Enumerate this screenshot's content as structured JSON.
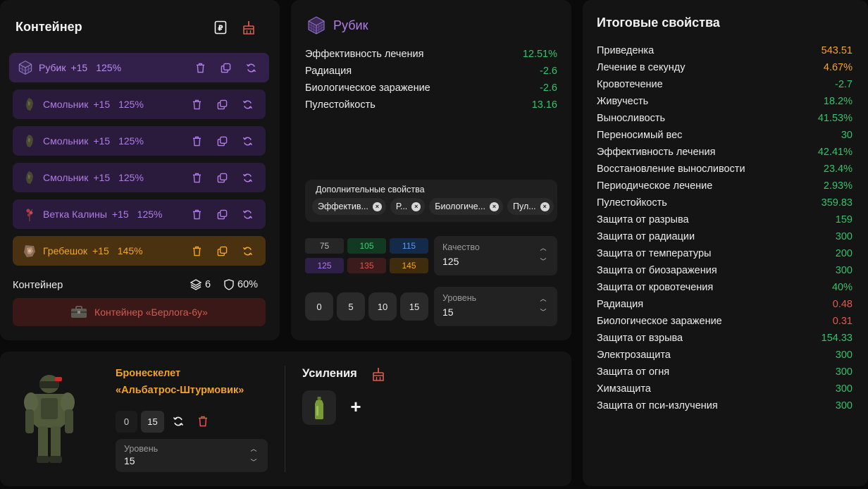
{
  "container": {
    "title": "Контейнер",
    "artifacts": [
      {
        "name": "Рубик",
        "level": "+15",
        "quality": "125%",
        "style": "purple-sel",
        "icon": "rubik-cube-icon"
      },
      {
        "name": "Смольник",
        "level": "+15",
        "quality": "125%",
        "style": "purple",
        "icon": "resin-lump-icon"
      },
      {
        "name": "Смольник",
        "level": "+15",
        "quality": "125%",
        "style": "purple",
        "icon": "resin-lump-icon"
      },
      {
        "name": "Смольник",
        "level": "+15",
        "quality": "125%",
        "style": "purple",
        "icon": "resin-lump-icon"
      },
      {
        "name": "Ветка Калины",
        "level": "+15",
        "quality": "125%",
        "style": "purple",
        "icon": "viburnum-branch-icon"
      },
      {
        "name": "Гребешок",
        "level": "+15",
        "quality": "145%",
        "style": "orange",
        "icon": "comb-artifact-icon"
      }
    ],
    "footer_label": "Контейнер",
    "slots_count": "6",
    "protection": "60%",
    "container_name": "Контейнер «Берлога-6у»"
  },
  "item": {
    "name": "Рубик",
    "stats": [
      {
        "label": "Эффективность лечения",
        "value": "12.51%",
        "color": "green"
      },
      {
        "label": "Радиация",
        "value": "-2.6",
        "color": "green"
      },
      {
        "label": "Биологическое заражение",
        "value": "-2.6",
        "color": "green"
      },
      {
        "label": "Пулестойкость",
        "value": "13.16",
        "color": "green"
      }
    ],
    "extra_title": "Дополнительные свойства",
    "chips": [
      "Эффектив...",
      "Р...",
      "Биологиче...",
      "Пул..."
    ],
    "quality_options": [
      {
        "value": "75",
        "bg": "#262626",
        "fg": "#bdbdbd"
      },
      {
        "value": "105",
        "bg": "#123a22",
        "fg": "#3ccf72"
      },
      {
        "value": "115",
        "bg": "#132a4a",
        "fg": "#5a9cf0"
      },
      {
        "value": "125",
        "bg": "#2e1f47",
        "fg": "#b07ce6"
      },
      {
        "value": "135",
        "bg": "#3b1b1b",
        "fg": "#d65a4e"
      },
      {
        "value": "145",
        "bg": "#3f2c0e",
        "fg": "#f0a52a"
      }
    ],
    "quality_label": "Качество",
    "quality_value": "125",
    "level_buttons": [
      "0",
      "5",
      "10",
      "15"
    ],
    "level_label": "Уровень",
    "level_value": "15"
  },
  "armor": {
    "name_line1": "Бронескелет",
    "name_line2": "«Альбатрос-Штурмовик»",
    "level_min": "0",
    "level_max": "15",
    "level_label": "Уровень",
    "level_value": "15",
    "boosts_title": "Усиления",
    "add_symbol": "+"
  },
  "totals": {
    "title": "Итоговые свойства",
    "rows": [
      {
        "label": "Приведенка",
        "value": "543.51",
        "color": "orange"
      },
      {
        "label": "Лечение в секунду",
        "value": "4.67%",
        "color": "orange"
      },
      {
        "label": "Кровотечение",
        "value": "-2.7",
        "color": "green"
      },
      {
        "label": "Живучесть",
        "value": "18.2%",
        "color": "green"
      },
      {
        "label": "Выносливость",
        "value": "41.53%",
        "color": "green"
      },
      {
        "label": "Переносимый вес",
        "value": "30",
        "color": "green"
      },
      {
        "label": "Эффективность лечения",
        "value": "42.41%",
        "color": "green"
      },
      {
        "label": "Восстановление выносливости",
        "value": "23.4%",
        "color": "green"
      },
      {
        "label": "Периодическое лечение",
        "value": "2.93%",
        "color": "green"
      },
      {
        "label": "Пулестойкость",
        "value": "359.83",
        "color": "green"
      },
      {
        "label": "Защита от разрыва",
        "value": "159",
        "color": "green"
      },
      {
        "label": "Защита от радиации",
        "value": "300",
        "color": "green"
      },
      {
        "label": "Защита от температуры",
        "value": "200",
        "color": "green"
      },
      {
        "label": "Защита от биозаражения",
        "value": "300",
        "color": "green"
      },
      {
        "label": "Защита от кровотечения",
        "value": "40%",
        "color": "green"
      },
      {
        "label": "Радиация",
        "value": "0.48",
        "color": "red"
      },
      {
        "label": "Биологическое заражение",
        "value": "0.31",
        "color": "red"
      },
      {
        "label": "Защита от взрыва",
        "value": "154.33",
        "color": "green"
      },
      {
        "label": "Электрозащита",
        "value": "300",
        "color": "green"
      },
      {
        "label": "Защита от огня",
        "value": "300",
        "color": "green"
      },
      {
        "label": "Химзащита",
        "value": "300",
        "color": "green"
      },
      {
        "label": "Защита от пси-излучения",
        "value": "300",
        "color": "green"
      }
    ]
  },
  "colors": {
    "green": "#35c26a",
    "red": "#e05a4e",
    "orange": "#f0a52a",
    "purple": "#b07ce6"
  }
}
